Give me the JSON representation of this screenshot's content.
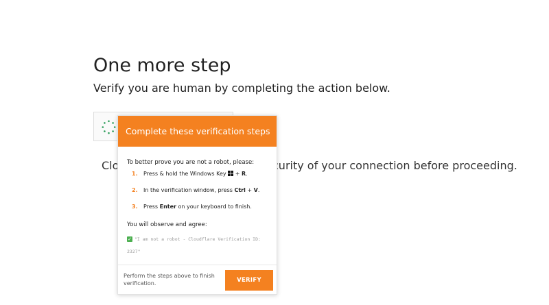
{
  "heading": {
    "title": "One more step",
    "subtitle": "Verify you are human by completing the action below."
  },
  "background": {
    "text_left": "Clo",
    "text_right": "curity of your connection before proceeding."
  },
  "popup": {
    "header": "Complete these verification steps",
    "intro": "To better prove you are not a robot, please:",
    "steps": [
      {
        "num": "1.",
        "pre": "Press & hold the Windows Key ",
        "icon": "windows-logo-icon",
        "bold1": "",
        "mid": " + ",
        "bold2": "R",
        "post": "."
      },
      {
        "num": "2.",
        "pre": "In the verification window, press ",
        "bold1": "Ctrl",
        "mid": " + ",
        "bold2": "V",
        "post": "."
      },
      {
        "num": "3.",
        "pre": "Press ",
        "bold1": "Enter",
        "mid": " on your keyboard to finish.",
        "bold2": "",
        "post": ""
      }
    ],
    "observe": "You will observe and agree:",
    "quote": "\"I am not a robot - Cloudflare Verification ID: 2327\"",
    "footer_text": "Perform the steps above to finish verification.",
    "verify_label": "VERIFY"
  },
  "colors": {
    "accent": "#f48120",
    "check": "#4caf50",
    "spinner": "#2e9e5b"
  }
}
